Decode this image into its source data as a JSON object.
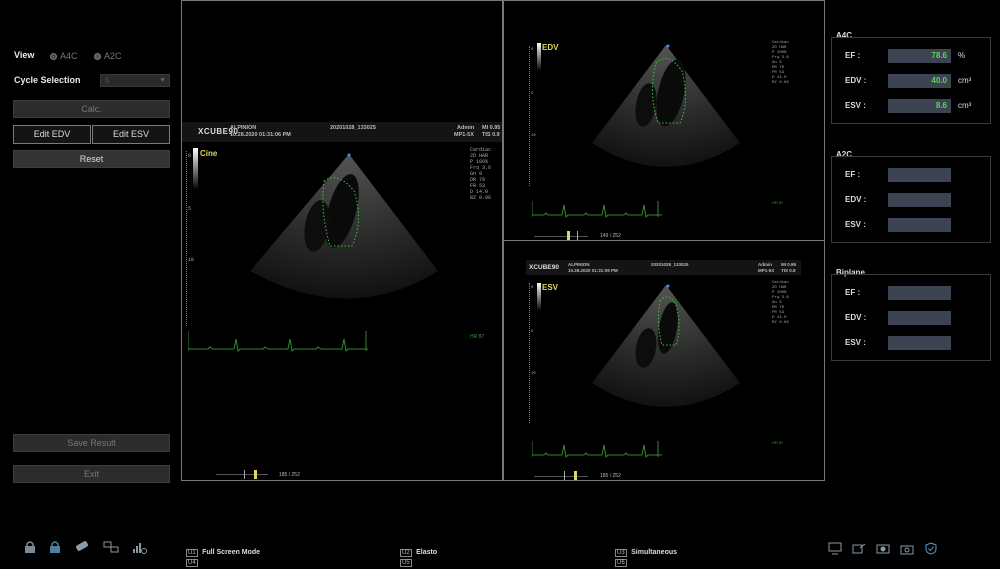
{
  "left_panel": {
    "view_label": "View",
    "view_options": [
      "A4C",
      "A2C"
    ],
    "view_selected": "A4C",
    "cycle_label": "Cycle Selection",
    "cycle_value": "5",
    "calc_button": "Calc.",
    "edit_edv_button": "Edit EDV",
    "edit_esv_button": "Edit ESV",
    "reset_button": "Reset",
    "save_button": "Save Result",
    "exit_button": "Exit"
  },
  "viewports": {
    "main": {
      "brand": "XCUBE90",
      "company": "ALPINION",
      "datetime": "10.28.2020 01:31:06 PM",
      "study_id": "20201028_133025",
      "user": "Admin",
      "probe": "MP1-5X",
      "mi": "MI 0.95",
      "tis": "TIS 0.9",
      "mode_label": "Cine",
      "params": [
        "Cardiac",
        "2D HAR",
        "P 100%",
        "Frq 3.6",
        "Gn 9",
        "DR 70",
        "FR 53",
        "D 14.0",
        "RZ 0.96"
      ],
      "depth_ticks": [
        "0",
        "5",
        "10"
      ],
      "hr": "HR 87",
      "frame": "185 / 252"
    },
    "edv": {
      "mode_label": "EDV",
      "params": [
        "Cardiac",
        "2D HAR",
        "P 100%",
        "Frq 3.6",
        "Gn 9",
        "DR 70",
        "FR 53",
        "D 14.0",
        "RZ 0.96"
      ],
      "depth_ticks": [
        "0",
        "5",
        "10"
      ],
      "hr": "HR 87",
      "frame": "149 / 252"
    },
    "esv": {
      "brand": "XCUBE90",
      "company": "ALPINION",
      "datetime": "10.28.2020 01:31:06 PM",
      "study_id": "20201028_133025",
      "user": "Admin",
      "probe": "MP1-5X",
      "mi": "MI 0.95",
      "tis": "TIS 0.9",
      "mode_label": "ESV",
      "params": [
        "Cardiac",
        "2D HAR",
        "P 100%",
        "Frq 3.6",
        "Gn 9",
        "DR 70",
        "FR 53",
        "D 14.0",
        "RZ 0.96"
      ],
      "depth_ticks": [
        "0",
        "5",
        "10"
      ],
      "hr": "HR 87",
      "frame": "185 / 252"
    }
  },
  "results": {
    "a4c": {
      "title": "A4C",
      "ef_label": "EF :",
      "ef_value": "78.6",
      "ef_unit": "%",
      "edv_label": "EDV :",
      "edv_value": "40.0",
      "edv_unit": "cm³",
      "esv_label": "ESV :",
      "esv_value": "8.6",
      "esv_unit": "cm³"
    },
    "a2c": {
      "title": "A2C",
      "ef_label": "EF :",
      "edv_label": "EDV :",
      "esv_label": "ESV :"
    },
    "biplane": {
      "title": "Biplane",
      "ef_label": "EF :",
      "edv_label": "EDV :",
      "esv_label": "ESV :"
    }
  },
  "bottom": {
    "u1_key": "U1",
    "u1_label": "Full Screen Mode",
    "u4_key": "U4",
    "u2_key": "U2",
    "u2_label": "Elasto",
    "u5_key": "U5",
    "u3_key": "U3",
    "u3_label": "Simultaneous",
    "u6_key": "U6"
  },
  "colors": {
    "accent_green": "#5bd45b",
    "mode_label": "#e0d85a",
    "trace": "#3a9a3a"
  }
}
